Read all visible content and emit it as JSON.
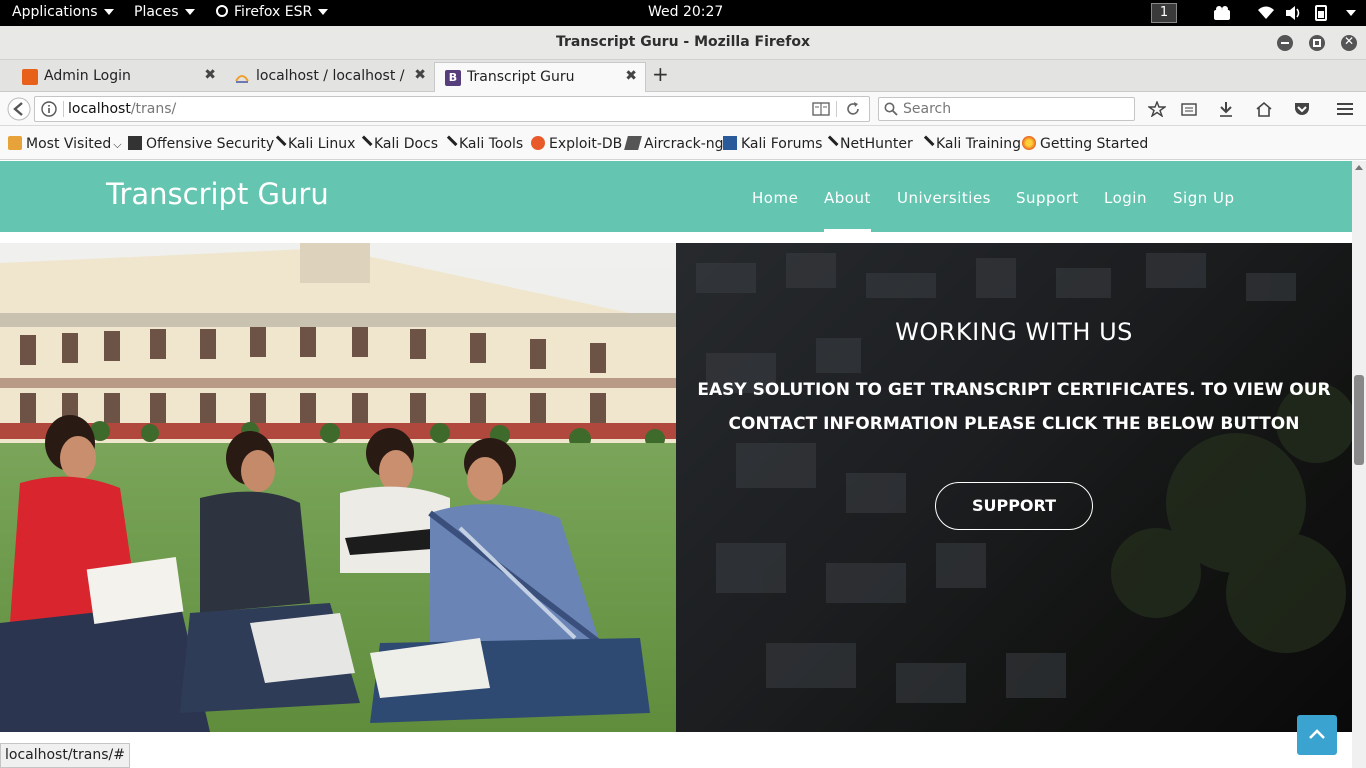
{
  "system_bar": {
    "applications": "Applications",
    "places": "Places",
    "app_name": "Firefox ESR",
    "clock": "Wed 20:27",
    "workspace": "1"
  },
  "window": {
    "title": "Transcript Guru - Mozilla Firefox"
  },
  "tabs": [
    {
      "label": "Admin Login",
      "icon": "app-logo-icon",
      "color": "#e8611a"
    },
    {
      "label": "localhost / localhost /...",
      "icon": "phpmyadmin-icon",
      "color": "#f0a030"
    },
    {
      "label": "Transcript Guru",
      "icon": "bootstrap-icon",
      "color": "#563d7c"
    }
  ],
  "navigation": {
    "url_host": "localhost",
    "url_path": "/trans/",
    "search_placeholder": "Search"
  },
  "bookmarks": [
    {
      "label": "Most Visited",
      "icon": "folder-icon"
    },
    {
      "label": "Offensive Security",
      "icon": "offsec-icon"
    },
    {
      "label": "Kali Linux",
      "icon": "kali-icon"
    },
    {
      "label": "Kali Docs",
      "icon": "kali-icon"
    },
    {
      "label": "Kali Tools",
      "icon": "kali-icon"
    },
    {
      "label": "Exploit-DB",
      "icon": "exploitdb-icon"
    },
    {
      "label": "Aircrack-ng",
      "icon": "aircrack-icon"
    },
    {
      "label": "Kali Forums",
      "icon": "forum-icon"
    },
    {
      "label": "NetHunter",
      "icon": "kali-icon"
    },
    {
      "label": "Kali Training",
      "icon": "kali-icon"
    },
    {
      "label": "Getting Started",
      "icon": "firefox-icon"
    }
  ],
  "site": {
    "brand": "Transcript Guru",
    "menu": [
      "Home",
      "About",
      "Universities",
      "Support",
      "Login",
      "Sign Up"
    ],
    "active_menu": "About",
    "header_color": "#64c5b1",
    "panel_heading": "WORKING WITH US",
    "panel_text": "EASY SOLUTION TO GET TRANSCRIPT CERTIFICATES. TO VIEW OUR CONTACT INFORMATION PLEASE CLICK THE BELOW BUTTON",
    "cta_label": "SUPPORT",
    "scroll_top_color": "#3ba3cf"
  },
  "status_bar": {
    "text": "localhost/trans/#"
  }
}
